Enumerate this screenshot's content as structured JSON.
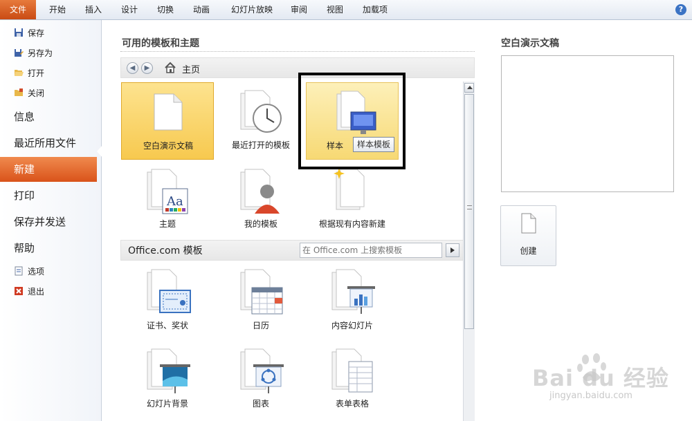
{
  "ribbon": {
    "tabs": [
      "文件",
      "开始",
      "插入",
      "设计",
      "切换",
      "动画",
      "幻灯片放映",
      "审阅",
      "视图",
      "加载项"
    ]
  },
  "left_menu": {
    "save": "保存",
    "save_as": "另存为",
    "open": "打开",
    "close": "关闭",
    "info": "信息",
    "recent": "最近所用文件",
    "new": "新建",
    "print": "打印",
    "save_send": "保存并发送",
    "help": "帮助",
    "options": "选项",
    "exit": "退出"
  },
  "center": {
    "section_title": "可用的模板和主题",
    "nav_home": "主页",
    "tiles": {
      "blank": "空白演示文稿",
      "recent_templates": "最近打开的模板",
      "sample_templates": "样本",
      "themes": "主题",
      "my_templates": "我的模板",
      "from_existing": "根据现有内容新建"
    },
    "tooltip": "样本模板",
    "office": {
      "title": "Office.com 模板",
      "search_placeholder": "在 Office.com 上搜索模板",
      "tiles": {
        "certificates": "证书、奖状",
        "calendar": "日历",
        "content_slides": "内容幻灯片",
        "slide_backgrounds": "幻灯片背景",
        "charts": "图表",
        "forms": "表单表格"
      }
    }
  },
  "preview": {
    "title": "空白演示文稿",
    "create_label": "创建"
  },
  "watermark": {
    "text": "Bai du 经验",
    "sub": "jingyan.baidu.com"
  }
}
